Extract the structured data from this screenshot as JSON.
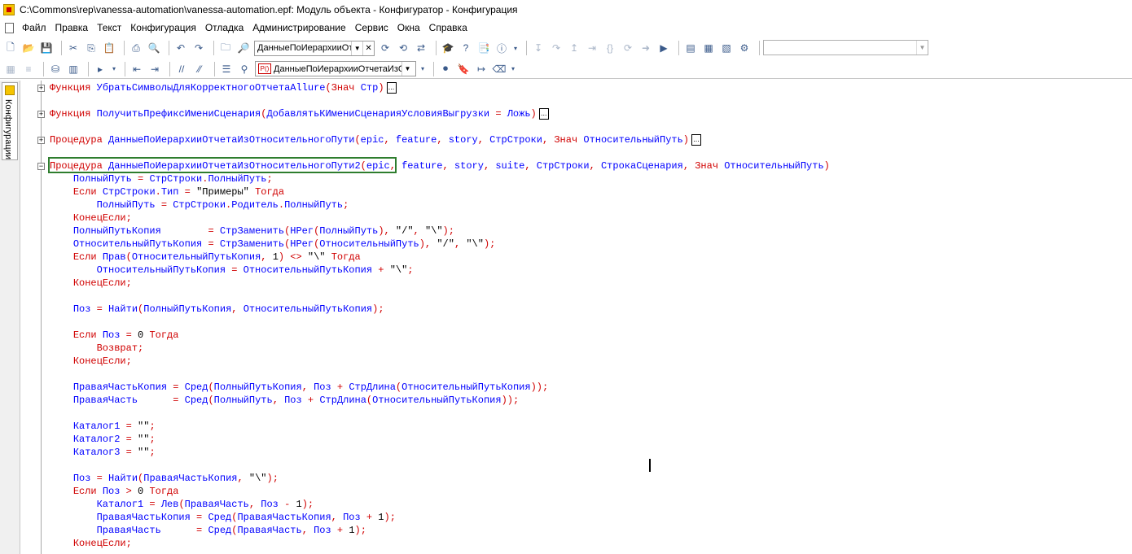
{
  "window": {
    "title": "C:\\Commons\\rep\\vanessa-automation\\vanessa-automation.epf: Модуль объекта - Конфигуратор - Конфигурация"
  },
  "menu": {
    "items": [
      "Файл",
      "Правка",
      "Текст",
      "Конфигурация",
      "Отладка",
      "Администрирование",
      "Сервис",
      "Окна",
      "Справка"
    ]
  },
  "toolbar": {
    "procedure_dropdown": "ДанныеПоИерархииОт",
    "module_dropdown": "ДанныеПоИерархииОтчетаИзС",
    "module_badge": "P()",
    "search_value": ""
  },
  "sidebar": {
    "tab_label": "Конфигурации"
  },
  "colors": {
    "keyword": "#d00000",
    "identifier": "#0000ff",
    "string": "#000000",
    "highlight_border": "#2e7d2e"
  },
  "editor": {
    "collapsed": [
      {
        "kw": "Функция",
        "name": "УбратьСимволыДляКорректногоОтчетаAllure",
        "params": "(Знач Стр)"
      },
      {
        "kw": "Функция",
        "name": "ПолучитьПрефиксИмениСценария",
        "params": "(ДобавлятьКИмениСценарияУсловияВыгрузки = Ложь)"
      },
      {
        "kw": "Процедура",
        "name": "ДанныеПоИерархииОтчетаИзОтносительногоПути",
        "params": "(epic, feature, story, СтрСтроки, Знач ОтносительныйПуть)"
      }
    ],
    "expanded_header": {
      "kw": "Процедура",
      "name": "ДанныеПоИерархииОтчетаИзОтносительногоПути2",
      "params": "(epic, feature, story, suite, СтрСтроки, СтрокаСценария, Знач ОтносительныйПуть)"
    },
    "body_lines": [
      "    ПолныйПуть = СтрСтроки.ПолныйПуть;",
      "    Если СтрСтроки.Тип = \"Примеры\" Тогда",
      "        ПолныйПуть = СтрСтроки.Родитель.ПолныйПуть;",
      "    КонецЕсли;",
      "    ПолныйПутьКопия        = СтрЗаменить(НРег(ПолныйПуть), \"/\", \"\\\");",
      "    ОтносительныйПутьКопия = СтрЗаменить(НРег(ОтносительныйПуть), \"/\", \"\\\");",
      "    Если Прав(ОтносительныйПутьКопия, 1) <> \"\\\" Тогда",
      "        ОтносительныйПутьКопия = ОтносительныйПутьКопия + \"\\\";",
      "    КонецЕсли;",
      "",
      "    Поз = Найти(ПолныйПутьКопия, ОтносительныйПутьКопия);",
      "",
      "    Если Поз = 0 Тогда",
      "        Возврат;",
      "    КонецЕсли;",
      "",
      "    ПраваяЧастьКопия = Сред(ПолныйПутьКопия, Поз + СтрДлина(ОтносительныйПутьКопия));",
      "    ПраваяЧасть      = Сред(ПолныйПуть, Поз + СтрДлина(ОтносительныйПутьКопия));",
      "",
      "    Каталог1 = \"\";",
      "    Каталог2 = \"\";",
      "    Каталог3 = \"\";",
      "",
      "    Поз = Найти(ПраваяЧастьКопия, \"\\\");",
      "    Если Поз > 0 Тогда",
      "        Каталог1 = Лев(ПраваяЧасть, Поз - 1);",
      "        ПраваяЧастьКопия = Сред(ПраваяЧастьКопия, Поз + 1);",
      "        ПраваяЧасть      = Сред(ПраваяЧасть, Поз + 1);",
      "    КонецЕсли;"
    ]
  }
}
